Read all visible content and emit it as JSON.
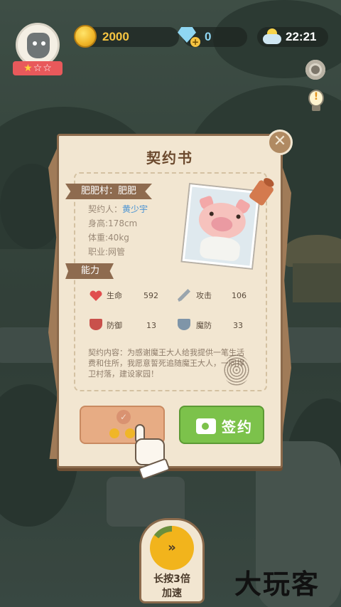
{
  "hud": {
    "stars": {
      "filled": 1,
      "total": 3
    },
    "coins": "2000",
    "gems": "0",
    "time": "22:21",
    "icons": {
      "gem_add": "+"
    }
  },
  "contract": {
    "title": "契约书",
    "close_icon": "✕",
    "name_ribbon": "肥肥村：肥肥",
    "contractor_label": "契约人：",
    "contractor_name": "黄少宇",
    "height": "身高:178cm",
    "weight": "体重:40kg",
    "job": "职业:网管",
    "ability_ribbon": "能力",
    "stats": {
      "hp_label": "生命",
      "hp_value": "592",
      "atk_label": "攻击",
      "atk_value": "106",
      "def_label": "防御",
      "def_value": "13",
      "mdef_label": "魔防",
      "mdef_value": "33"
    },
    "description": "契约内容：为感谢魔王大人给我提供一笔生活费和住所，我愿意誓死追随魔王大人，一同捍卫村落，建设家园！",
    "free_button_check": "✓",
    "sign_button": "签约"
  },
  "speedup": {
    "icon": "»",
    "line1": "长按3倍",
    "line2": "加速"
  },
  "watermark": "大玩客",
  "colors": {
    "coin": "#f6c541",
    "gem": "#8fd6f2",
    "sign_green": "#7cc24b",
    "free_peach": "#e7ac84",
    "paper": "#f2e6d1",
    "contractor_blue": "#4a93d3"
  }
}
